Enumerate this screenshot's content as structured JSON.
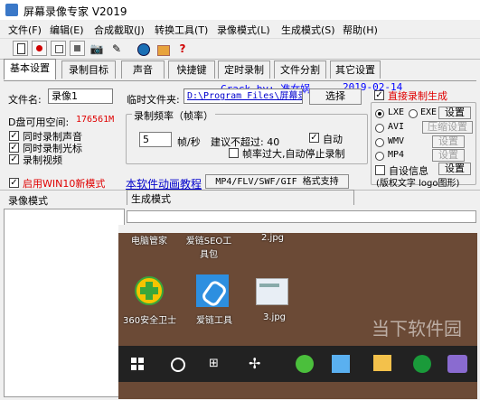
{
  "window": {
    "title": "屏幕录像专家 V2019"
  },
  "menu": [
    "文件(F)",
    "编辑(E)",
    "合成截取(J)",
    "转换工具(T)",
    "录像模式(L)",
    "生成模式(S)",
    "帮助(H)"
  ],
  "toolbar": {
    "crack_text": "Crack by: 准女娲",
    "date_text": "2019-02-14"
  },
  "tabs": [
    "基本设置",
    "录制目标",
    "声音",
    "快捷键",
    "定时录制",
    "文件分割",
    "其它设置"
  ],
  "basic": {
    "filename_label": "文件名:",
    "filename_value": "录像1",
    "tempdir_label": "临时文件夹:",
    "tempdir_value": "D:\\Program Files\\屏幕录",
    "choose_button": "选择",
    "disk_space_label": "D盘可用空间:",
    "disk_space_value": "176561M",
    "rec_sound": "同时录制声音",
    "rec_cursor": "同时录制光标",
    "rec_video": "录制视频",
    "win10_mode": "启用WIN10新模式",
    "freq_group_label": "录制频率（帧率）",
    "fps_value": "5",
    "fps_unit": "帧/秒",
    "advice": "建议不超过: 40",
    "auto_label": "自动",
    "auto_stop": "帧率过大,自动停止录制",
    "tutorial_link": "本软件动画教程",
    "formats_label": "MP4/FLV/SWF/GIF  格式支持"
  },
  "right": {
    "direct_gen": "直接录制生成",
    "lxe": "LXE",
    "exe": "EXE",
    "avi": "AVI",
    "wmv": "WMV",
    "mp4": "MP4",
    "settings_btn": "设置",
    "compress_btn": "压缩设置",
    "custom_info": "自设信息",
    "custom_info_btn": "设置",
    "copyright": "(版权文字 logo图形)"
  },
  "bottom": {
    "record_mode_label": "录像模式",
    "gen_mode_label": "生成模式"
  },
  "preview": {
    "top_labels": [
      "电脑管家",
      "爱链SEO工具包",
      "2.jpg"
    ],
    "icons": [
      "360安全卫士",
      "爱链工具",
      "3.jpg"
    ],
    "watermark": "当下软件园"
  }
}
